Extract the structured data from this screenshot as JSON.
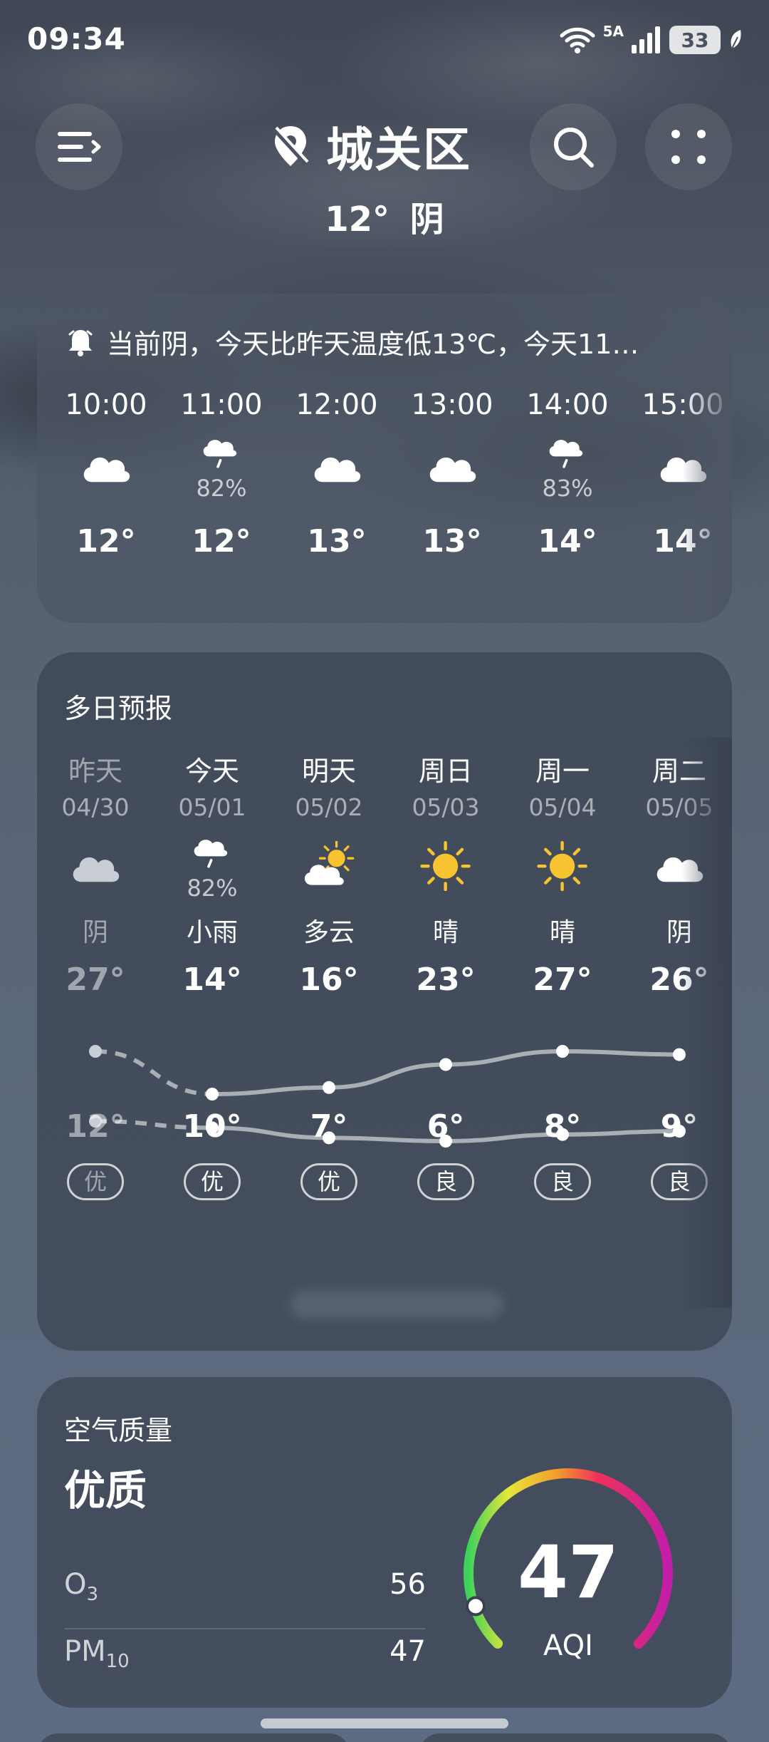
{
  "status_bar": {
    "time": "09:34",
    "network": "5A",
    "battery": "33"
  },
  "header": {
    "location": "城关区",
    "current_temp": "12°",
    "current_condition": "阴"
  },
  "hourly": {
    "alert": "当前阴，今天比昨天温度低13℃，今天11…",
    "items": [
      {
        "time": "10:00",
        "icon": "cloudy-icon",
        "pop": "",
        "temp": "12°"
      },
      {
        "time": "11:00",
        "icon": "light-rain-icon",
        "pop": "82%",
        "temp": "12°"
      },
      {
        "time": "12:00",
        "icon": "cloudy-icon",
        "pop": "",
        "temp": "13°"
      },
      {
        "time": "13:00",
        "icon": "cloudy-icon",
        "pop": "",
        "temp": "13°"
      },
      {
        "time": "14:00",
        "icon": "light-rain-icon",
        "pop": "83%",
        "temp": "14°"
      },
      {
        "time": "15:00",
        "icon": "cloudy-icon",
        "pop": "",
        "temp": "14°"
      }
    ]
  },
  "daily": {
    "title": "多日预报",
    "items": [
      {
        "day": "昨天",
        "date": "04/30",
        "icon": "cloudy-icon",
        "pop": "",
        "condition": "阴",
        "high": "27°",
        "low": "12°",
        "aqi": "优"
      },
      {
        "day": "今天",
        "date": "05/01",
        "icon": "light-rain-icon",
        "pop": "82%",
        "condition": "小雨",
        "high": "14°",
        "low": "10°",
        "aqi": "优"
      },
      {
        "day": "明天",
        "date": "05/02",
        "icon": "partly-cloudy-icon",
        "pop": "",
        "condition": "多云",
        "high": "16°",
        "low": "7°",
        "aqi": "优"
      },
      {
        "day": "周日",
        "date": "05/03",
        "icon": "sunny-icon",
        "pop": "",
        "condition": "晴",
        "high": "23°",
        "low": "6°",
        "aqi": "良"
      },
      {
        "day": "周一",
        "date": "05/04",
        "icon": "sunny-icon",
        "pop": "",
        "condition": "晴",
        "high": "27°",
        "low": "8°",
        "aqi": "良"
      },
      {
        "day": "周二",
        "date": "05/05",
        "icon": "cloudy-icon",
        "pop": "",
        "condition": "阴",
        "high": "26°",
        "low": "9°",
        "aqi": "良"
      }
    ]
  },
  "air_quality": {
    "title": "空气质量",
    "quality": "优质",
    "o3_label": "O",
    "o3_sub": "3",
    "o3_value": "56",
    "pm10_label": "PM",
    "pm10_sub": "10",
    "pm10_value": "47",
    "aqi_value": "47",
    "aqi_unit": "AQI",
    "gauge_fraction": 0.094
  }
}
